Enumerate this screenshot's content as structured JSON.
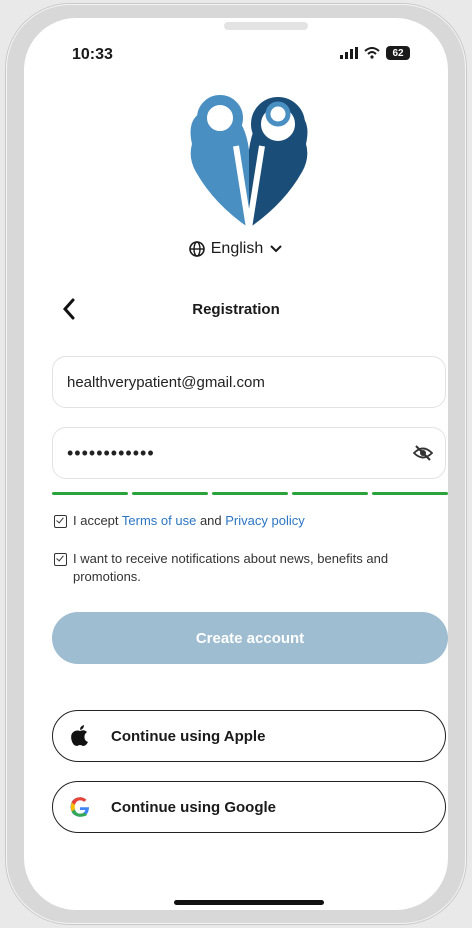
{
  "status": {
    "time": "10:33",
    "battery": "62"
  },
  "language": {
    "label": "English"
  },
  "header": {
    "title": "Registration"
  },
  "form": {
    "email_value": "healthverypatient@gmail.com",
    "password_value": "••••••••••••",
    "password_strength_segments": 5
  },
  "terms": {
    "prefix": "I accept ",
    "terms_link": "Terms of use",
    "and": " and ",
    "privacy_link": "Privacy policy"
  },
  "notifications": {
    "label": "I want to receive notifications about news, benefits and promotions."
  },
  "actions": {
    "create_account": "Create account",
    "apple": "Continue using Apple",
    "google": "Continue using Google"
  },
  "colors": {
    "brand_light": "#4a8fc2",
    "brand_dark": "#1a4e78",
    "strength": "#2aa43a",
    "create_disabled": "#9fbdd0",
    "link": "#2b76c4"
  },
  "icons": [
    "signal-icon",
    "wifi-icon",
    "battery-icon",
    "globe-icon",
    "chevron-down-icon",
    "back-arrow-icon",
    "eye-off-icon",
    "checkbox-icon",
    "apple-icon",
    "google-icon"
  ]
}
